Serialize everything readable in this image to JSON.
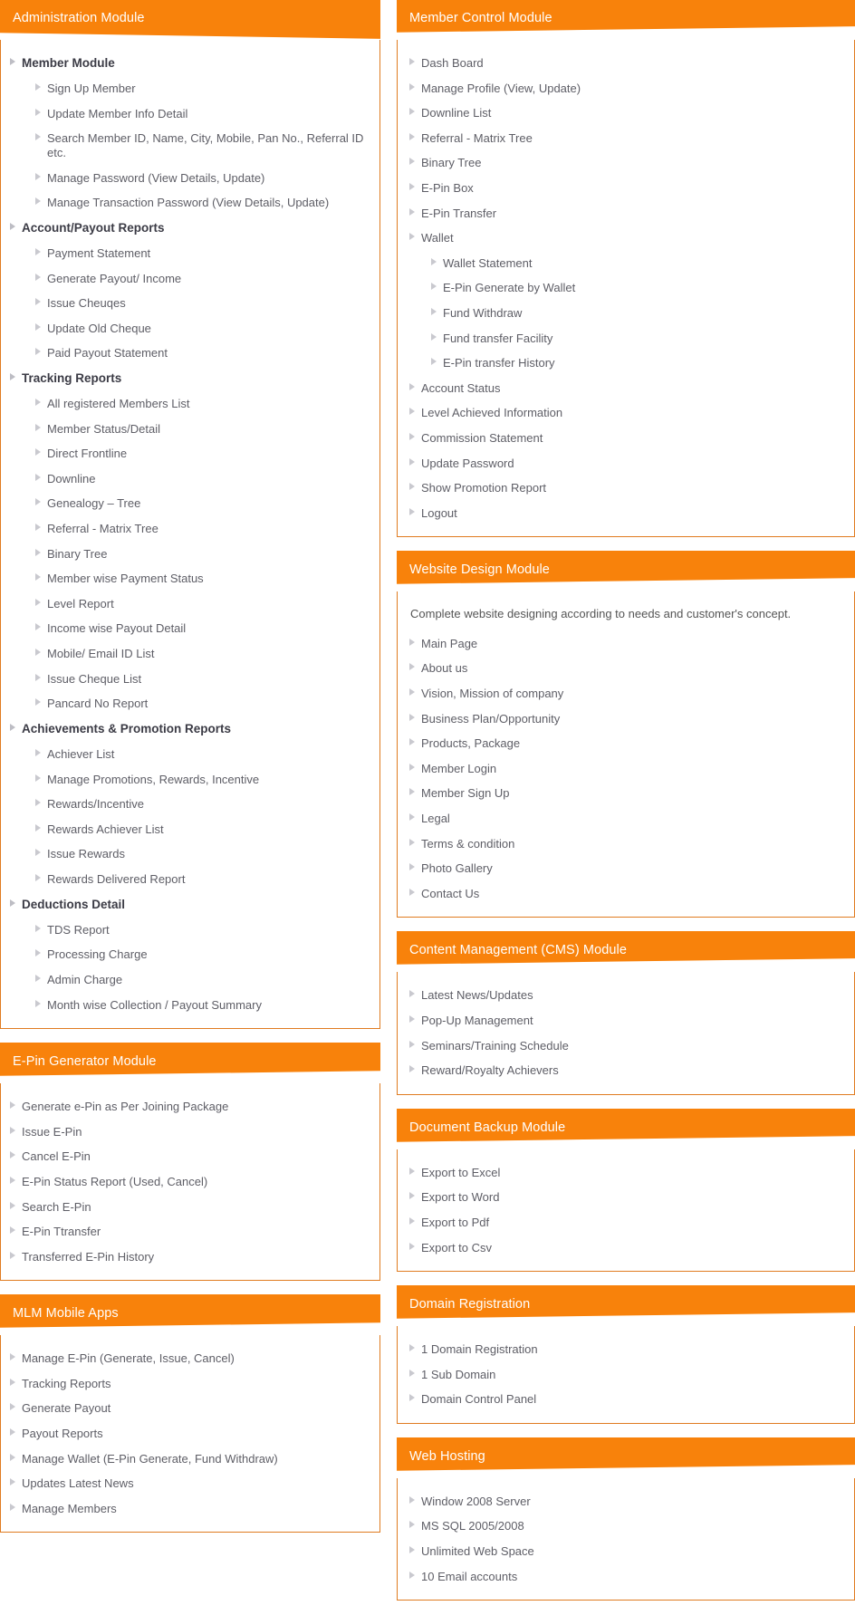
{
  "colors": {
    "accent": "#f8820b",
    "border": "#e07b20",
    "header_text": "#ffffff",
    "item_text": "#5e5e66",
    "group_text": "#3b3b45",
    "bullet": "#c9c9cf"
  },
  "icons": {
    "bullet": "caret-right-icon"
  },
  "left_column": {
    "panels": [
      {
        "title": "Administration Module",
        "groups": [
          {
            "label": "Member Module",
            "items": [
              "Sign Up Member",
              "Update Member Info Detail",
              "Search Member ID, Name, City, Mobile, Pan No., Referral ID etc.",
              "Manage Password (View Details, Update)",
              "Manage Transaction Password (View Details, Update)"
            ]
          },
          {
            "label": "Account/Payout Reports",
            "items": [
              "Payment Statement",
              "Generate Payout/ Income",
              "Issue Cheuqes",
              "Update Old Cheque",
              "Paid Payout Statement"
            ]
          },
          {
            "label": "Tracking Reports",
            "items": [
              "All registered Members List",
              "Member Status/Detail",
              "Direct Frontline",
              "Downline",
              "Genealogy – Tree",
              "Referral - Matrix Tree",
              "Binary Tree",
              "Member wise Payment Status",
              "Level Report",
              "Income wise Payout Detail",
              "Mobile/ Email ID List",
              "Issue Cheque List",
              "Pancard No Report"
            ]
          },
          {
            "label": "Achievements & Promotion Reports",
            "items": [
              "Achiever List",
              "Manage Promotions, Rewards, Incentive",
              "Rewards/Incentive",
              "Rewards Achiever List",
              "Issue Rewards",
              "Rewards Delivered Report"
            ]
          },
          {
            "label": "Deductions Detail",
            "items": [
              "TDS Report",
              "Processing Charge",
              "Admin Charge",
              "Month wise Collection / Payout Summary"
            ]
          }
        ]
      },
      {
        "title": "E-Pin Generator Module",
        "items": [
          "Generate e-Pin as Per Joining Package",
          "Issue E-Pin",
          "Cancel E-Pin",
          "E-Pin Status Report (Used, Cancel)",
          "Search E-Pin",
          "E-Pin Ttransfer",
          "Transferred E-Pin History"
        ]
      },
      {
        "title": "MLM Mobile Apps",
        "items": [
          "Manage E-Pin (Generate, Issue, Cancel)",
          "Tracking Reports",
          "Generate Payout",
          "Payout Reports",
          "Manage Wallet (E-Pin Generate, Fund Withdraw)",
          "Updates Latest News",
          "Manage Members"
        ]
      }
    ]
  },
  "right_column": {
    "panels": [
      {
        "title": "Member Control Module",
        "items": [
          {
            "label": "Dash Board",
            "level": 1
          },
          {
            "label": "Manage Profile (View, Update)",
            "level": 1
          },
          {
            "label": "Downline List",
            "level": 1
          },
          {
            "label": "Referral - Matrix Tree",
            "level": 1
          },
          {
            "label": "Binary Tree",
            "level": 1
          },
          {
            "label": "E-Pin Box",
            "level": 1
          },
          {
            "label": "E-Pin Transfer",
            "level": 1
          },
          {
            "label": "Wallet",
            "level": 1
          },
          {
            "label": "Wallet Statement",
            "level": 2
          },
          {
            "label": "E-Pin Generate by Wallet",
            "level": 2
          },
          {
            "label": "Fund Withdraw",
            "level": 2
          },
          {
            "label": "Fund transfer Facility",
            "level": 2
          },
          {
            "label": "E-Pin transfer History",
            "level": 2
          },
          {
            "label": "Account Status",
            "level": 1
          },
          {
            "label": "Level Achieved Information",
            "level": 1
          },
          {
            "label": "Commission Statement",
            "level": 1
          },
          {
            "label": "Update Password",
            "level": 1
          },
          {
            "label": "Show Promotion Report",
            "level": 1
          },
          {
            "label": "Logout",
            "level": 1
          }
        ]
      },
      {
        "title": "Website Design Module",
        "blurb": "Complete website designing according to needs and customer's concept.",
        "items": [
          {
            "label": "Main Page",
            "level": 1
          },
          {
            "label": "About us",
            "level": 1
          },
          {
            "label": "Vision, Mission of company",
            "level": 1
          },
          {
            "label": "Business Plan/Opportunity",
            "level": 1
          },
          {
            "label": "Products, Package",
            "level": 1
          },
          {
            "label": "Member Login",
            "level": 1
          },
          {
            "label": "Member Sign Up",
            "level": 1
          },
          {
            "label": "Legal",
            "level": 1
          },
          {
            "label": "Terms & condition",
            "level": 1
          },
          {
            "label": "Photo Gallery",
            "level": 1
          },
          {
            "label": "Contact Us",
            "level": 1
          }
        ]
      },
      {
        "title": "Content Management (CMS) Module",
        "items": [
          {
            "label": "Latest News/Updates",
            "level": 1
          },
          {
            "label": "Pop-Up Management",
            "level": 1
          },
          {
            "label": "Seminars/Training Schedule",
            "level": 1
          },
          {
            "label": "Reward/Royalty Achievers",
            "level": 1
          }
        ]
      },
      {
        "title": "Document Backup Module",
        "items": [
          {
            "label": "Export to Excel",
            "level": 1
          },
          {
            "label": "Export to Word",
            "level": 1
          },
          {
            "label": "Export to Pdf",
            "level": 1
          },
          {
            "label": "Export to Csv",
            "level": 1
          }
        ]
      },
      {
        "title": "Domain Registration",
        "items": [
          {
            "label": "1 Domain Registration",
            "level": 1
          },
          {
            "label": "1 Sub Domain",
            "level": 1
          },
          {
            "label": "Domain Control Panel",
            "level": 1
          }
        ]
      },
      {
        "title": "Web Hosting",
        "items": [
          {
            "label": "Window 2008 Server",
            "level": 1
          },
          {
            "label": "MS SQL 2005/2008",
            "level": 1
          },
          {
            "label": "Unlimited Web Space",
            "level": 1
          },
          {
            "label": "10 Email accounts",
            "level": 1
          }
        ]
      }
    ]
  }
}
